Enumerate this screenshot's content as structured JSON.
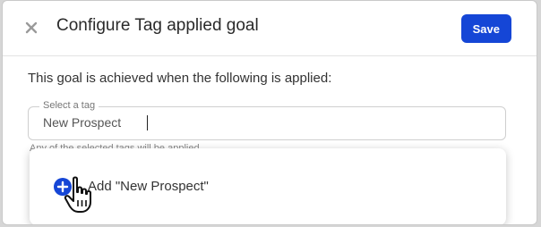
{
  "modal": {
    "title": "Configure Tag applied goal",
    "save_label": "Save",
    "close_icon": "close-icon"
  },
  "form": {
    "description": "This goal is achieved when the following is applied:",
    "tag_field": {
      "label": "Select a tag",
      "value": "New Prospect"
    },
    "helper_text": "Any of the selected tags will be applied"
  },
  "dropdown": {
    "add_option_label": "Add \"New Prospect\"",
    "add_icon": "plus-circle-icon"
  },
  "cursor": "hand-pointer-icon",
  "colors": {
    "primary": "#1546d6",
    "text": "#2a2a2a",
    "muted": "#777777"
  }
}
